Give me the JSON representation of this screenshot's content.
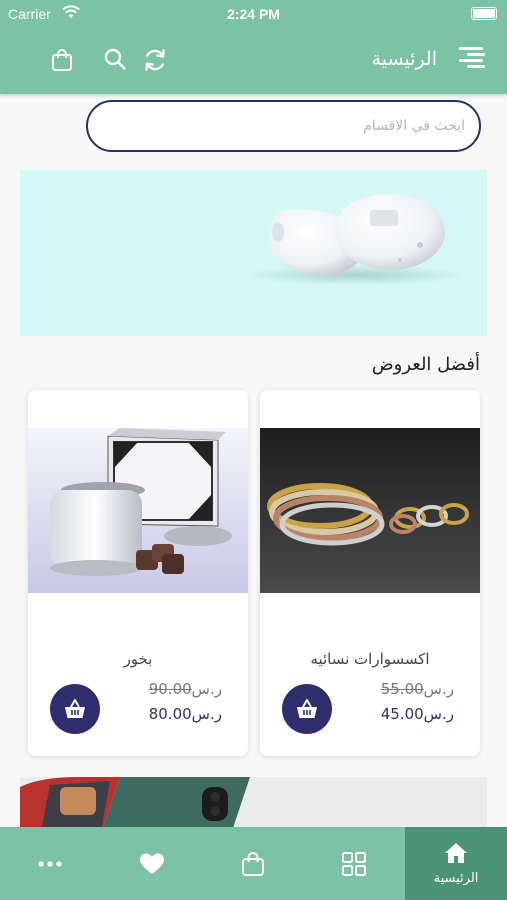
{
  "status_bar": {
    "carrier": "Carrier",
    "time": "2:24 PM"
  },
  "header": {
    "title": "الرئيسية",
    "icons": [
      "menu-icon",
      "refresh-icon",
      "search-icon",
      "bag-icon"
    ]
  },
  "search": {
    "placeholder": "ابحث في الاقسام",
    "value": ""
  },
  "section": {
    "title": "أفضل العروض"
  },
  "products": [
    {
      "name": "اكسسوارات نسائيه",
      "old_price": "55.00",
      "new_price": "45.00",
      "currency": "ر.س"
    },
    {
      "name": "بخور",
      "old_price": "90.00",
      "new_price": "80.00",
      "currency": "ر.س"
    }
  ],
  "tabbar": {
    "items": [
      {
        "icon": "home-icon",
        "label": "الرئيسية",
        "active": true
      },
      {
        "icon": "grid-icon"
      },
      {
        "icon": "bag-icon"
      },
      {
        "icon": "heart-icon"
      },
      {
        "icon": "more-icon"
      }
    ]
  },
  "colors": {
    "primary": "#7cc3a5",
    "primary_dark": "#4a9474",
    "accent": "#2f2e6e",
    "banner_bg": "#d3f8f5"
  }
}
